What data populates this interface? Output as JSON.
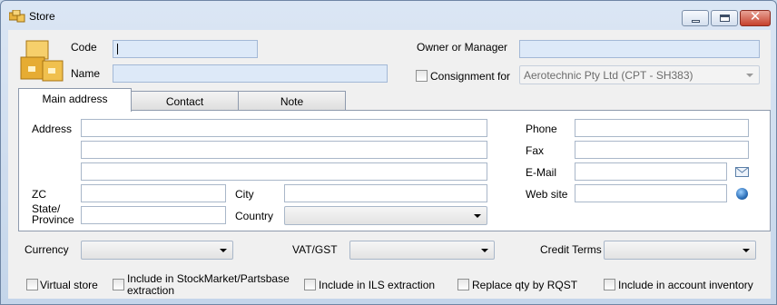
{
  "window": {
    "title": "Store",
    "close_glyph": "✕"
  },
  "header": {
    "code_label": "Code",
    "code_value": "",
    "name_label": "Name",
    "name_value": "",
    "owner_label": "Owner or Manager",
    "owner_value": "",
    "consignment_label": "Consignment for",
    "consignment_value": "Aerotechnic Pty Ltd (CPT - SH383)"
  },
  "tabs": [
    {
      "label": "Main address"
    },
    {
      "label": "Contact"
    },
    {
      "label": "Note"
    }
  ],
  "address": {
    "address_label": "Address",
    "address_line1": "",
    "address_line2": "",
    "address_line3": "",
    "zc_label": "ZC",
    "zc_value": "",
    "city_label": "City",
    "city_value": "",
    "state_label_line1": "State/",
    "state_label_line2": "Province",
    "state_value": "",
    "country_label": "Country",
    "country_value": "",
    "phone_label": "Phone",
    "phone_value": "",
    "fax_label": "Fax",
    "fax_value": "",
    "email_label": "E-Mail",
    "email_value": "",
    "website_label": "Web site",
    "website_value": ""
  },
  "finance": {
    "currency_label": "Currency",
    "currency_value": "",
    "vat_label": "VAT/GST",
    "vat_value": "",
    "credit_terms_label": "Credit Terms",
    "credit_terms_value": ""
  },
  "options": {
    "virtual_store": "Virtual store",
    "stockmarket_line1": "Include in StockMarket/Partsbase",
    "stockmarket_line2": "extraction",
    "ils": "Include in ILS extraction",
    "replace_qty": "Replace qty by RQST",
    "account_inventory": "Include in account inventory"
  },
  "icons": {
    "app": "store-icon",
    "logo": "store-boxes-icon",
    "email": "mail-icon",
    "website": "globe-icon",
    "dropdown": "chevron-down-icon"
  },
  "colors": {
    "title_bar": "#dbe6f4",
    "required_field": "#dde9f8",
    "close_button": "#c6412c"
  }
}
